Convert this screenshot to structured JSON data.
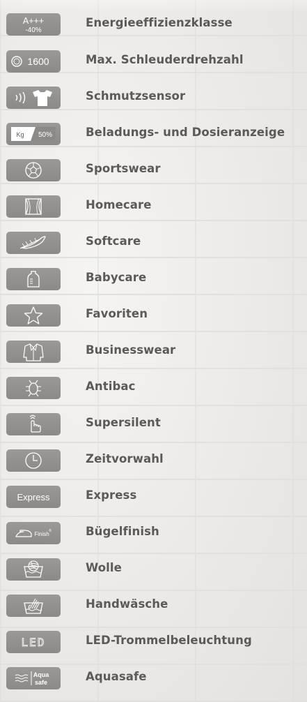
{
  "features": [
    {
      "icon": "energy-class-icon",
      "badge": "A+++",
      "badge_sub": "-40%",
      "label": "Energieeffizienzklasse"
    },
    {
      "icon": "spin-speed-icon",
      "badge": "1600",
      "label": "Max. Schleuderdrehzahl"
    },
    {
      "icon": "dirt-sensor-icon",
      "label": "Schmutzsensor"
    },
    {
      "icon": "load-indicator-icon",
      "badge": "Kg",
      "badge_sub": "50%",
      "label": "Beladungs- und Dosieranzeige"
    },
    {
      "icon": "sportswear-icon",
      "label": "Sportswear"
    },
    {
      "icon": "homecare-icon",
      "label": "Homecare"
    },
    {
      "icon": "softcare-icon",
      "label": "Softcare"
    },
    {
      "icon": "babycare-icon",
      "label": "Babycare"
    },
    {
      "icon": "favorites-icon",
      "label": "Favoriten"
    },
    {
      "icon": "businesswear-icon",
      "label": "Businesswear"
    },
    {
      "icon": "antibac-icon",
      "label": "Antibac"
    },
    {
      "icon": "supersilent-icon",
      "label": "Supersilent"
    },
    {
      "icon": "timer-icon",
      "label": "Zeitvorwahl"
    },
    {
      "icon": "express-icon",
      "badge": "Express",
      "label": "Express"
    },
    {
      "icon": "iron-finish-icon",
      "badge": "Finish",
      "label": "Bügelfinish"
    },
    {
      "icon": "wool-icon",
      "label": "Wolle"
    },
    {
      "icon": "handwash-icon",
      "label": "Handwäsche"
    },
    {
      "icon": "led-icon",
      "badge": "LED",
      "label": "LED-Trommelbeleuchtung"
    },
    {
      "icon": "aquasafe-icon",
      "badge": "Aqua",
      "badge_sub": "safe",
      "label": "Aquasafe"
    }
  ]
}
